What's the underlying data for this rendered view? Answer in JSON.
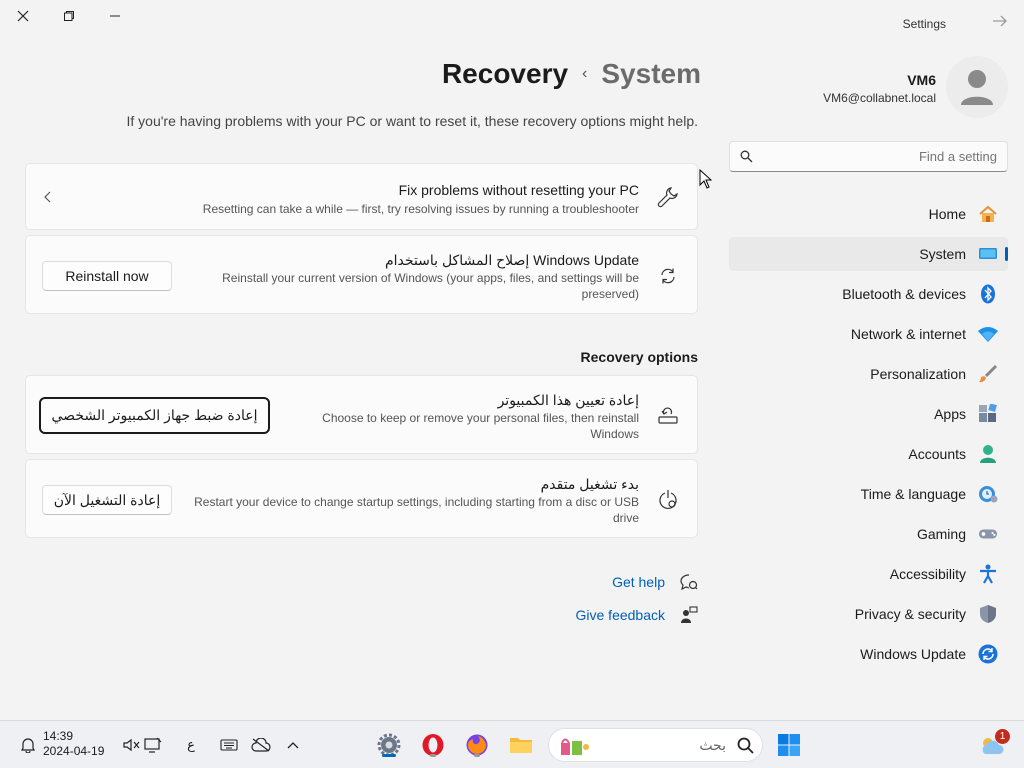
{
  "window": {
    "app_title": "Settings",
    "breadcrumb_current": "Recovery",
    "breadcrumb_separator": "‹",
    "breadcrumb_parent": "System",
    "subtitle": "If you're having problems with your PC or want to reset it, these recovery options might help."
  },
  "user": {
    "name": "VM6",
    "email": "VM6@collabnet.local"
  },
  "search": {
    "placeholder": "Find a setting"
  },
  "sidebar": {
    "items": [
      {
        "label": "Home",
        "icon": "home-icon"
      },
      {
        "label": "System",
        "icon": "system-icon",
        "active": true
      },
      {
        "label": "Bluetooth & devices",
        "icon": "bluetooth-icon"
      },
      {
        "label": "Network & internet",
        "icon": "wifi-icon"
      },
      {
        "label": "Personalization",
        "icon": "brush-icon"
      },
      {
        "label": "Apps",
        "icon": "apps-icon"
      },
      {
        "label": "Accounts",
        "icon": "accounts-icon"
      },
      {
        "label": "Time & language",
        "icon": "time-language-icon"
      },
      {
        "label": "Gaming",
        "icon": "gaming-icon"
      },
      {
        "label": "Accessibility",
        "icon": "accessibility-icon"
      },
      {
        "label": "Privacy & security",
        "icon": "shield-icon"
      },
      {
        "label": "Windows Update",
        "icon": "windows-update-icon"
      }
    ]
  },
  "cards": {
    "fix": {
      "title": "Fix problems without resetting your PC",
      "desc": "Resetting can take a while — first, try resolving issues by running a troubleshooter"
    },
    "wu": {
      "title": "إصلاح المشاكل باستخدام Windows Update",
      "desc_line1": "Reinstall your current version of Windows (your apps, files, and settings will be",
      "desc_line2": "preserved)",
      "button": "Reinstall now"
    },
    "section_label": "Recovery options",
    "reset": {
      "title": "إعادة تعيين هذا الكمبيوتر",
      "desc_line1": "Choose to keep or remove your personal files, then reinstall",
      "desc_line2": "Windows",
      "button": "إعادة ضبط جهاز الكمبيوتر الشخصي"
    },
    "advanced": {
      "title": "بدء تشغيل متقدم",
      "desc_line1": "Restart your device to change startup settings, including starting from a disc or USB",
      "desc_line2": "drive",
      "button": "إعادة التشغيل الآن"
    }
  },
  "links": {
    "get_help": "Get help",
    "give_feedback": "Give feedback"
  },
  "taskbar": {
    "time": "14:39",
    "date": "2024-04-19",
    "input_lang": "ع",
    "search_placeholder": "بحث",
    "notification_count": "1"
  },
  "colors": {
    "accent": "#005fb8",
    "background": "#f3f3f3",
    "card": "#fbfbfb"
  }
}
